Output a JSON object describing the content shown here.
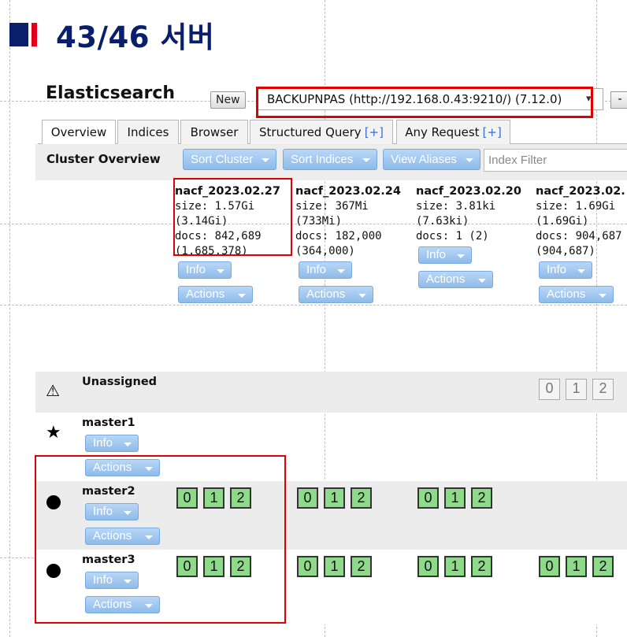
{
  "slide": {
    "title": "43/46 서버"
  },
  "app": {
    "brand": "Elasticsearch",
    "new_button": "New",
    "cluster_url": "BACKUPNPAS (http://192.168.0.43:9210/) (7.12.0)",
    "right_button": "-"
  },
  "tabs": [
    {
      "label": "Overview",
      "plus": ""
    },
    {
      "label": "Indices",
      "plus": ""
    },
    {
      "label": "Browser",
      "plus": ""
    },
    {
      "label": "Structured Query",
      "plus": "[+]"
    },
    {
      "label": "Any Request",
      "plus": "[+]"
    }
  ],
  "toolbar": {
    "title": "Cluster Overview",
    "sort_cluster": "Sort Cluster",
    "sort_indices": "Sort Indices",
    "view_aliases": "View Aliases",
    "filter_placeholder": "Index Filter"
  },
  "buttons": {
    "info": "Info",
    "actions": "Actions"
  },
  "indices": [
    {
      "name": "nacf_2023.02.27",
      "size": "size: 1.57Gi",
      "size_total": "(3.14Gi)",
      "docs": "docs: 842,689",
      "docs_total": "(1,685,378)"
    },
    {
      "name": "nacf_2023.02.24",
      "size": "size: 367Mi",
      "size_total": "(733Mi)",
      "docs": "docs: 182,000",
      "docs_total": "(364,000)"
    },
    {
      "name": "nacf_2023.02.20",
      "size": "size: 3.81ki",
      "size_total": "(7.63ki)",
      "docs": "docs: 1 (2)",
      "docs_total": ""
    },
    {
      "name": "nacf_2023.02.",
      "size": "size: 1.69Gi",
      "size_total": "(1.69Gi)",
      "docs": "docs: 904,687",
      "docs_total": "(904,687)"
    }
  ],
  "nodes": {
    "unassigned": {
      "label": "Unassigned",
      "shards": [
        "0",
        "1",
        "2"
      ]
    },
    "master1": {
      "label": "master1"
    },
    "master2": {
      "label": "master2",
      "shards": [
        "0",
        "1",
        "2"
      ]
    },
    "master3": {
      "label": "master3",
      "shards": [
        "0",
        "1",
        "2"
      ]
    }
  },
  "colors": {
    "accent_blue": "#8ebbea",
    "shard_green": "#8fd98a",
    "title_navy": "#0a1f6b",
    "highlight_red": "#e00000"
  }
}
